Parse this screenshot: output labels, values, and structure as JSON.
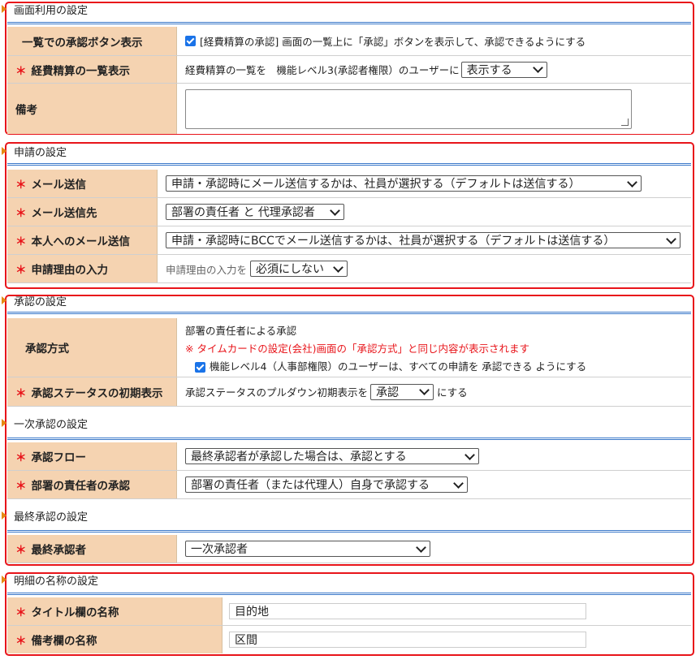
{
  "s1": {
    "header": "画面利用の設定",
    "approve_button": {
      "label": "一覧での承認ボタン表示",
      "checkbox_text": "[経費精算の承認] 画面の一覧上に「承認」ボタンを表示して、承認できるようにする"
    },
    "list_display": {
      "label": "経費精算の一覧表示",
      "prefix": "経費精算の一覧を　機能レベル3(承認者権限）のユーザーに",
      "value": "表示する"
    },
    "remarks": {
      "label": "備考"
    }
  },
  "s2": {
    "header": "申請の設定",
    "mail_send": {
      "label": "メール送信",
      "value": "申請・承認時にメール送信するかは、社員が選択する（デフォルトは送信する）"
    },
    "mail_to": {
      "label": "メール送信先",
      "value": "部署の責任者 と 代理承認者"
    },
    "mail_self": {
      "label": "本人へのメール送信",
      "value": "申請・承認時にBCCでメール送信するかは、社員が選択する（デフォルトは送信する）"
    },
    "reason": {
      "label": "申請理由の入力",
      "prefix": "申請理由の入力を",
      "value": "必須にしない"
    }
  },
  "s3": {
    "header": "承認の設定",
    "method": {
      "label": "承認方式",
      "line1": "部署の責任者による承認",
      "note": "※ タイムカードの設定(会社)画面の「承認方式」と同じ内容が表示されます",
      "checkbox_text": "機能レベル4（人事部権限）のユーザーは、すべての申請を 承認できる ようにする"
    },
    "status": {
      "label": "承認ステータスの初期表示",
      "prefix": "承認ステータスのプルダウン初期表示を",
      "value": "承認",
      "suffix": "にする"
    },
    "first_header": "一次承認の設定",
    "flow": {
      "label": "承認フロー",
      "value": "最終承認者が承認した場合は、承認とする"
    },
    "dept_approval": {
      "label": "部署の責任者の承認",
      "value": "部署の責任者（または代理人）自身で承認する"
    },
    "final_header": "最終承認の設定",
    "final": {
      "label": "最終承認者",
      "value": "一次承認者"
    }
  },
  "s4": {
    "header": "明細の名称の設定",
    "title_col": {
      "label": "タイトル欄の名称",
      "value": "目的地"
    },
    "remarks_col": {
      "label": "備考欄の名称",
      "value": "区間"
    }
  },
  "required_mark": "＊",
  "colors": {
    "required": "#e8141a",
    "label_bg": "#f5d3b1",
    "accent_line": "#3a78c9",
    "section_border": "#e8141a"
  }
}
